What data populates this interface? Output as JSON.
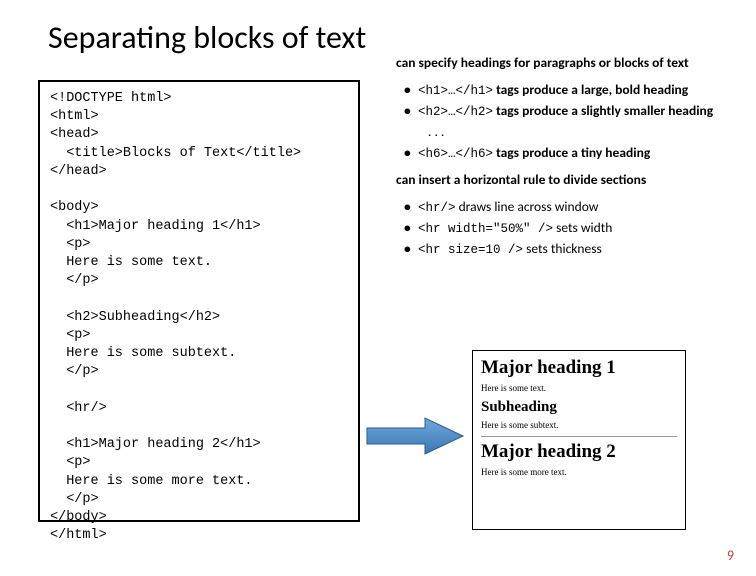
{
  "title": "Separating blocks of text",
  "code": "<!DOCTYPE html>\n<html>\n<head>\n  <title>Blocks of Text</title>\n</head>\n\n<body>\n  <h1>Major heading 1</h1>\n  <p>\n  Here is some text.\n  </p>\n\n  <h2>Subheading</h2>\n  <p>\n  Here is some subtext.\n  </p>\n\n  <hr/>\n\n  <h1>Major heading 2</h1>\n  <p>\n  Here is some more text.\n  </p>\n</body>\n</html>",
  "right": {
    "intro1": "can specify headings for paragraphs or blocks of text",
    "b1_code": "<h1>…</h1>",
    "b1_rest": " tags produce a large, bold heading",
    "b2_code": "<h2>…</h2>",
    "b2_rest": " tags produce a slightly smaller heading",
    "dots": ". . .",
    "b3_code": "<h6>…</h6>",
    "b3_rest": " tags produce a tiny heading",
    "intro2": "can insert a horizontal rule to divide sections",
    "c1_code": "<hr/>",
    "c1_rest": " draws line across window",
    "c2_code": "<hr width=\"50%\" />",
    "c2_rest": " sets width",
    "c3_code": "<hr size=10 />",
    "c3_rest": " sets thickness"
  },
  "preview": {
    "h1a": "Major heading 1",
    "p1": "Here is some text.",
    "h2": "Subheading",
    "p2": "Here is some subtext.",
    "h1b": "Major heading 2",
    "p3": "Here is some more text."
  },
  "pagenum": "9"
}
